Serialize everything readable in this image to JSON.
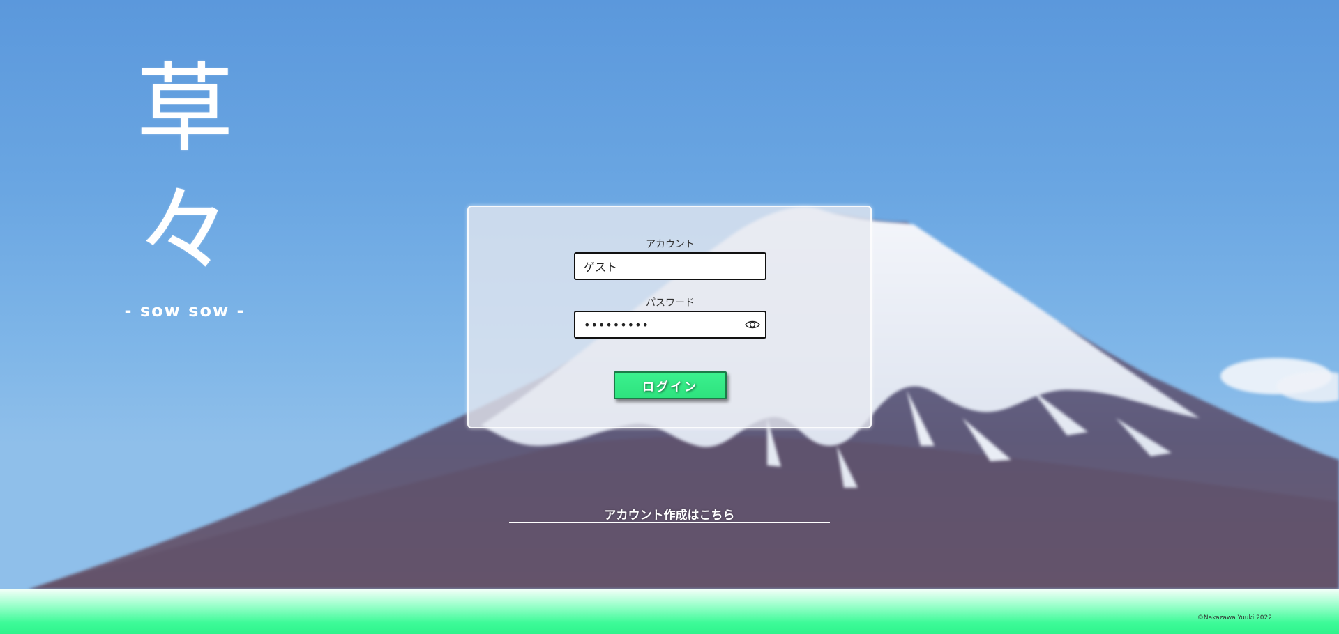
{
  "logo": {
    "kanji_top": "草",
    "kanji_bottom": "々",
    "subtitle": "- sow sow -"
  },
  "login_form": {
    "account_label": "アカウント",
    "account_value": "ゲスト",
    "password_label": "パスワード",
    "password_value": "•••••••••",
    "login_button": "ログイン"
  },
  "signup_link": "アカウント作成はこちら",
  "footer": {
    "copyright": "©Nakazawa Yuuki 2022"
  },
  "colors": {
    "accent_green": "#2ee37e",
    "sky_blue": "#5b98dc"
  },
  "icons": {
    "password_toggle": "eye-icon"
  }
}
